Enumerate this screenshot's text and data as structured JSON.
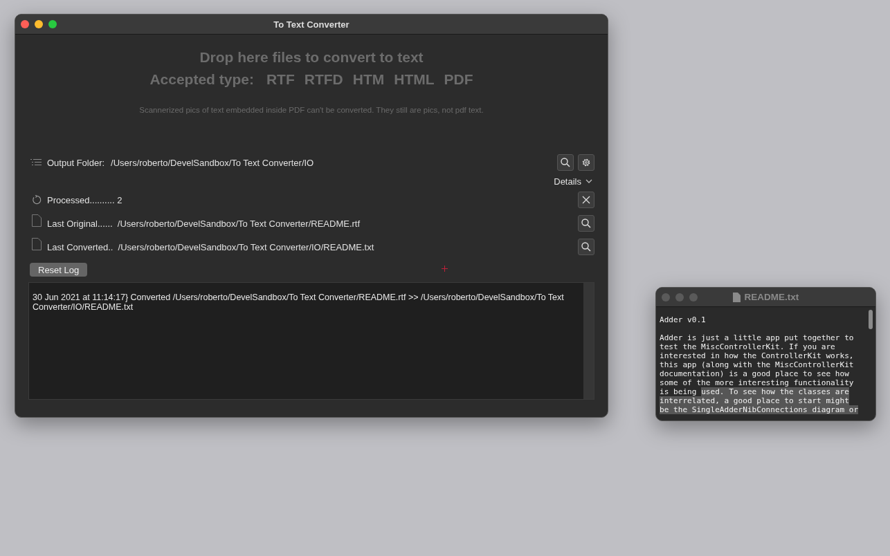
{
  "main_window": {
    "title": "To Text Converter",
    "drop_title": "Drop here files to convert to text",
    "accepted_label": "Accepted type:",
    "accepted_types": [
      "RTF",
      "RTFD",
      "HTM",
      "HTML",
      "PDF"
    ],
    "note": "Scannerized pics of text embedded inside PDF can't be converted. They still are pics, not pdf text.",
    "output_folder": {
      "label": "Output Folder:",
      "path": "/Users/roberto/DevelSandbox/To Text Converter/IO"
    },
    "details": {
      "label": "Details",
      "expanded": false
    },
    "status_rows": [
      {
        "kind": "processed",
        "text": "Processed.......... 2"
      },
      {
        "kind": "original",
        "text": "Last Original......  /Users/roberto/DevelSandbox/To Text Converter/README.rtf"
      },
      {
        "kind": "converted",
        "text": "Last Converted..  /Users/roberto/DevelSandbox/To Text Converter/IO/README.txt"
      }
    ],
    "reset_button": "Reset Log",
    "log": "30 Jun 2021 at 11:14:17} Converted /Users/roberto/DevelSandbox/To Text Converter/README.rtf  >>  /Users/roberto/DevelSandbox/To Text Converter/IO/README.txt"
  },
  "text_window": {
    "title": "README.txt",
    "paragraphs": [
      [
        [
          {
            "text": "Adder v0.1",
            "selected": false
          }
        ]
      ],
      [
        [
          {
            "text": "Adder is just a little app put together to",
            "selected": false
          }
        ],
        [
          {
            "text": "test the MiscControllerKit. If you are",
            "selected": false
          }
        ],
        [
          {
            "text": "interested in how the ControllerKit works,",
            "selected": false
          }
        ],
        [
          {
            "text": "this app (along with the MiscControllerKit",
            "selected": false
          }
        ],
        [
          {
            "text": "documentation) is a good place to see how",
            "selected": false
          }
        ],
        [
          {
            "text": "some of the more interesting functionality",
            "selected": false
          }
        ],
        [
          {
            "text": "is being ",
            "selected": false
          },
          {
            "text": "used. To see how the classes are",
            "selected": true
          }
        ],
        [
          {
            "text": "interrelated, a good place to start might",
            "selected": true
          }
        ],
        [
          {
            "text": "be the SingleAdderNibConnections diagram or",
            "selected": true
          }
        ]
      ]
    ]
  }
}
